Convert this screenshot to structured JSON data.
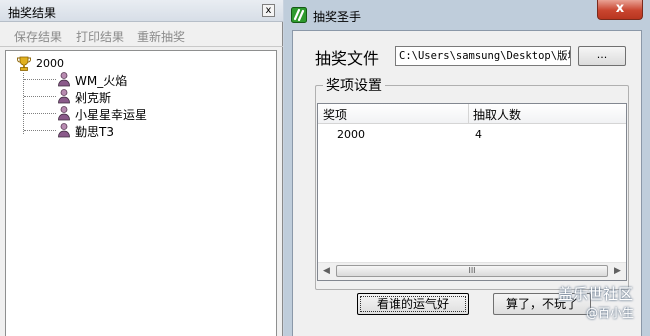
{
  "left_window": {
    "title": "抽奖结果",
    "close_glyph": "x",
    "menu": [
      "保存结果",
      "打印结果",
      "重新抽奖"
    ],
    "tree": {
      "root_label": "2000",
      "root_icon": "trophy-icon",
      "child_icon": "person-icon",
      "children": [
        "WM_火焰",
        "剁克斯",
        "小星星幸运星",
        "勤思T3"
      ]
    }
  },
  "right_window": {
    "title": "抽奖圣手",
    "app_icon": "lottery-app-icon",
    "close_glyph": "x",
    "file_label": "抽奖文件",
    "file_path": "C:\\Users\\samsung\\Desktop\\版块",
    "browse_label": "...",
    "group_title": "奖项设置",
    "table": {
      "columns": [
        "奖项",
        "抽取人数"
      ],
      "rows": [
        [
          "2000",
          "4"
        ]
      ]
    },
    "scroll_left": "◀",
    "scroll_right": "▶",
    "scroll_grip": "III",
    "lucky_button": "看谁的运气好",
    "quit_button": "算了，不玩了"
  },
  "watermark": {
    "line1": "盖乐世社区",
    "line2": "@百小生"
  },
  "colors": {
    "desktop": "#c9d3df",
    "window_chrome": "#bfcddb",
    "client": "#f0f0f0",
    "close_red": "#c9452f",
    "disabled_text": "#8b8b8b"
  }
}
